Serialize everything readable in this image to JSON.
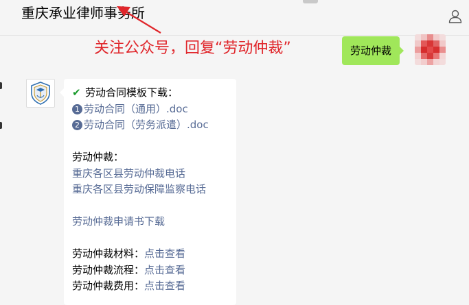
{
  "header": {
    "title": "重庆承业律师事务所",
    "user_icon": "user-icon"
  },
  "annotation": {
    "text": "关注公众号，回复“劳动仲裁”",
    "color": "#e0262b"
  },
  "self_message": {
    "text": "劳动仲裁",
    "bubble_color": "#a0e75a"
  },
  "reply": {
    "template_heading": "劳动合同模板下载：",
    "template_links": [
      {
        "num": "1",
        "text": "劳动合同（通用）.doc"
      },
      {
        "num": "2",
        "text": "劳动合同（劳务派遣）.doc"
      }
    ],
    "arbitration_heading": "劳动仲裁：",
    "arbitration_links": [
      "重庆各区县劳动仲裁电话",
      "重庆各区县劳动保障监察电话"
    ],
    "application_link": "劳动仲裁申请书下载",
    "items": [
      {
        "label": "劳动仲裁材料：",
        "link": "点击查看"
      },
      {
        "label": "劳动仲裁流程：",
        "link": "点击查看"
      },
      {
        "label": "劳动仲裁费用：",
        "link": "点击查看"
      }
    ],
    "link_color": "#576b95"
  }
}
